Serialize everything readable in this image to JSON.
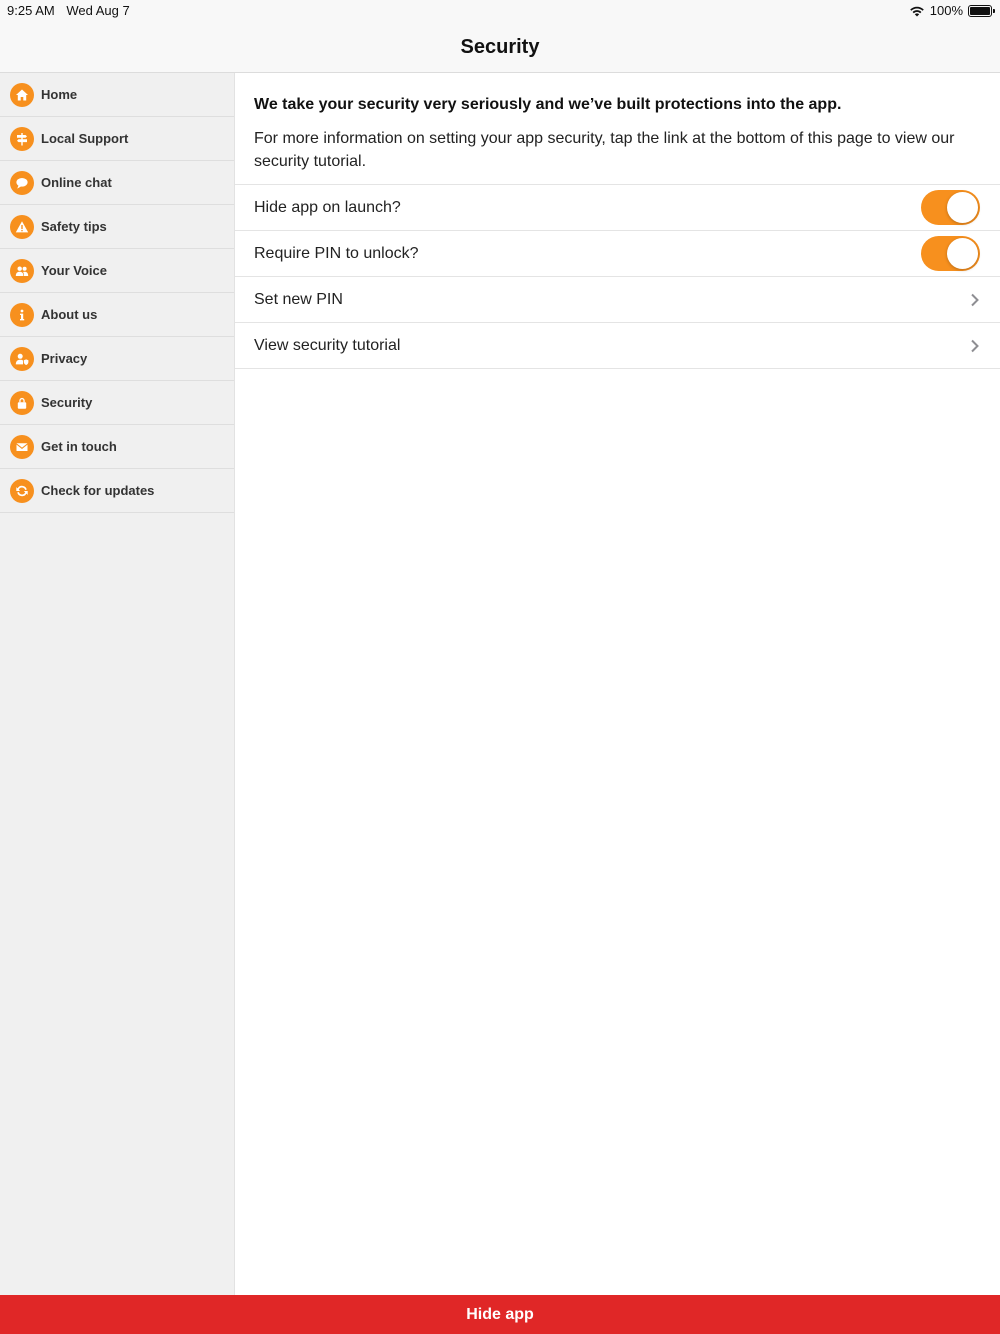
{
  "status": {
    "time": "9:25 AM",
    "date": "Wed Aug 7",
    "battery": "100%"
  },
  "nav": {
    "title": "Security"
  },
  "colors": {
    "accent": "#f7901e",
    "hide_bar": "#e02727"
  },
  "sidebar": {
    "items": [
      {
        "label": "Home",
        "icon": "home-icon"
      },
      {
        "label": "Local Support",
        "icon": "signpost-icon"
      },
      {
        "label": "Online chat",
        "icon": "chat-icon"
      },
      {
        "label": "Safety tips",
        "icon": "warning-icon"
      },
      {
        "label": "Your Voice",
        "icon": "people-icon"
      },
      {
        "label": "About us",
        "icon": "info-icon"
      },
      {
        "label": "Privacy",
        "icon": "privacy-user-icon"
      },
      {
        "label": "Security",
        "icon": "lock-icon"
      },
      {
        "label": "Get in touch",
        "icon": "envelope-icon"
      },
      {
        "label": "Check for updates",
        "icon": "refresh-icon"
      }
    ]
  },
  "content": {
    "intro_bold": "We take your security very seriously and we’ve built protections into the app.",
    "intro_text": "For more information on setting your app security, tap the link at the bottom of this page to view our security tutorial.",
    "hide_on_launch": {
      "label": "Hide app on launch?",
      "enabled": true
    },
    "require_pin": {
      "label": "Require PIN to unlock?",
      "enabled": true
    },
    "set_pin": {
      "label": "Set new PIN"
    },
    "tutorial": {
      "label": "View security tutorial"
    }
  },
  "bottom": {
    "label": "Hide app"
  }
}
